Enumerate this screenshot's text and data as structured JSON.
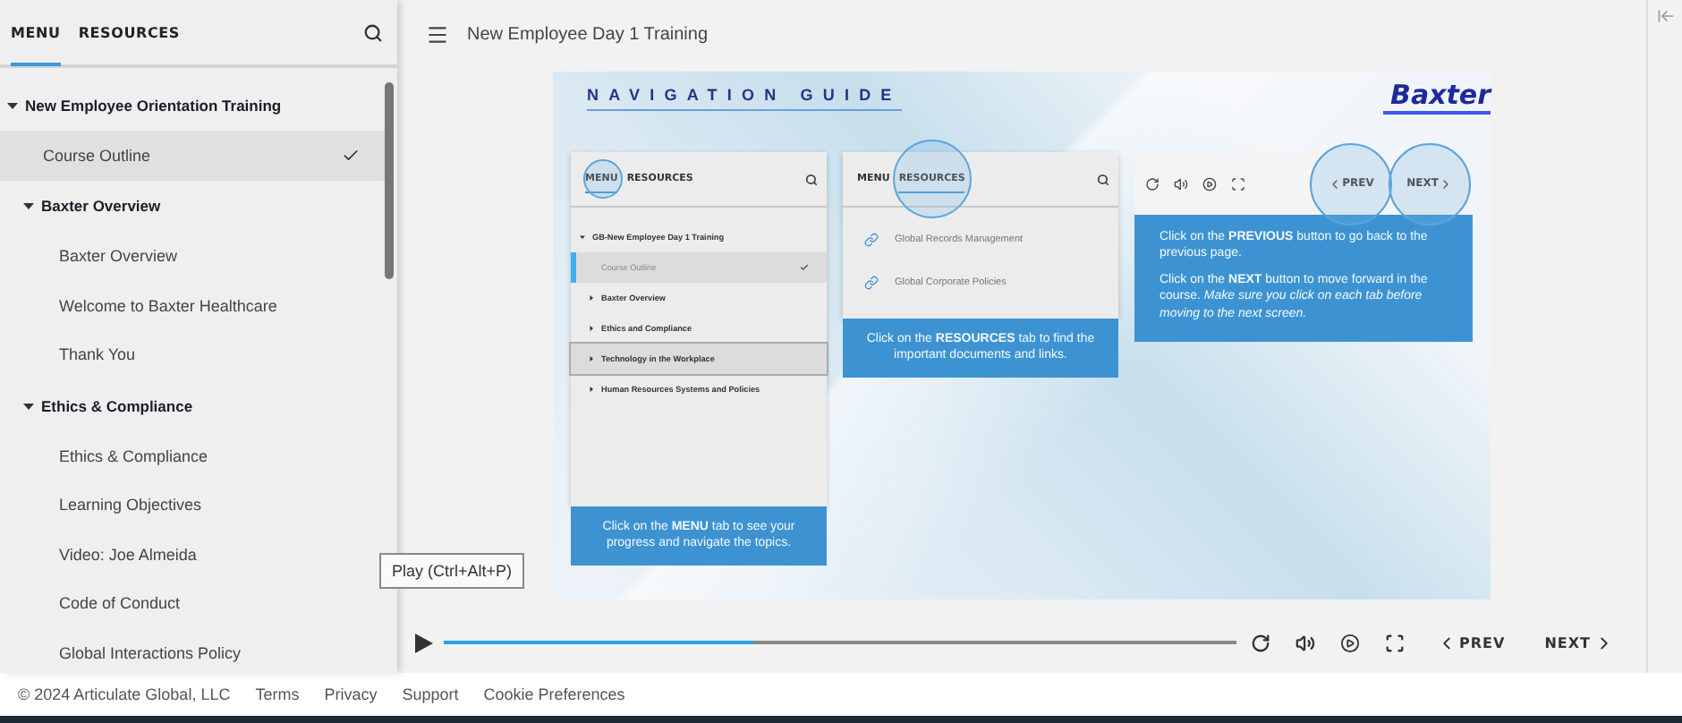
{
  "sidebar": {
    "tabs": [
      {
        "label": "MENU",
        "selected": true
      },
      {
        "label": "RESOURCES",
        "selected": false
      }
    ],
    "tree": [
      {
        "kind": "section",
        "label": "New Employee Orientation Training",
        "expanded": true,
        "children": [
          {
            "kind": "page",
            "label": "Course Outline",
            "selected": true,
            "checked": true
          },
          {
            "kind": "section",
            "label": "Baxter Overview",
            "expanded": true,
            "children": [
              {
                "kind": "page",
                "label": "Baxter Overview",
                "selected": false,
                "checked": false
              },
              {
                "kind": "page",
                "label": "Welcome to Baxter Healthcare",
                "selected": false,
                "checked": false
              },
              {
                "kind": "page",
                "label": "Thank You",
                "selected": false,
                "checked": false
              }
            ]
          },
          {
            "kind": "section",
            "label": "Ethics & Compliance",
            "expanded": true,
            "children": [
              {
                "kind": "page",
                "label": "Ethics & Compliance",
                "selected": false,
                "checked": false
              },
              {
                "kind": "page",
                "label": "Learning Objectives",
                "selected": false,
                "checked": false
              },
              {
                "kind": "page",
                "label": "Video: Joe Almeida",
                "selected": false,
                "checked": false
              },
              {
                "kind": "page",
                "label": "Code of Conduct",
                "selected": false,
                "checked": false
              },
              {
                "kind": "page",
                "label": "Global Interactions Policy",
                "selected": false,
                "checked": false
              }
            ]
          }
        ]
      }
    ]
  },
  "header": {
    "title": "New Employee Day 1 Training"
  },
  "slide": {
    "title": "NAVIGATION GUIDE",
    "logo": "Baxter",
    "menu_panel": {
      "tabs": [
        {
          "label": "MENU",
          "selected": true,
          "highlighted": true
        },
        {
          "label": "RESOURCES",
          "selected": false,
          "highlighted": false
        }
      ],
      "items": [
        {
          "kind": "course",
          "label": "GB-New Employee Day 1 Training",
          "selected": false,
          "checked": false,
          "outlined": false
        },
        {
          "kind": "page",
          "label": "Course Outline",
          "selected": true,
          "checked": true,
          "outlined": false
        },
        {
          "kind": "section",
          "label": "Baxter Overview",
          "selected": false,
          "checked": false,
          "outlined": false
        },
        {
          "kind": "section",
          "label": "Ethics and Compliance",
          "selected": false,
          "checked": false,
          "outlined": false
        },
        {
          "kind": "section",
          "label": "Technology in the Workplace",
          "selected": false,
          "checked": false,
          "outlined": true
        },
        {
          "kind": "section",
          "label": "Human Resources Systems and Policies",
          "selected": false,
          "checked": false,
          "outlined": false
        }
      ],
      "caption": "Click on the **MENU** tab to see your progress and navigate the topics."
    },
    "resources_panel": {
      "tabs": [
        {
          "label": "MENU",
          "selected": false,
          "highlighted": false
        },
        {
          "label": "RESOURCES",
          "selected": true,
          "highlighted": true
        }
      ],
      "links": [
        "Global Records Management",
        "Global Corporate Policies"
      ],
      "caption": "Click on the **RESOURCES** tab to  find the important documents and links."
    },
    "nav_panel": {
      "prev": {
        "label": "PREV",
        "highlighted": true
      },
      "next": {
        "label": "NEXT",
        "highlighted": true
      },
      "captions": [
        "Click on the **PREVIOUS** button to go back to the previous page.",
        "Click on the **NEXT** button to move forward in the course. *Make sure you click on each tab before moving to the next screen.*"
      ]
    }
  },
  "player": {
    "progress": {
      "level": 0.39
    },
    "prev": "PREV",
    "next": "NEXT",
    "tooltip": "Play (Ctrl+Alt+P)"
  },
  "footer": {
    "copyright": "© 2024 Articulate Global, LLC",
    "links": [
      "Terms",
      "Privacy",
      "Support",
      "Cookie Preferences"
    ]
  }
}
